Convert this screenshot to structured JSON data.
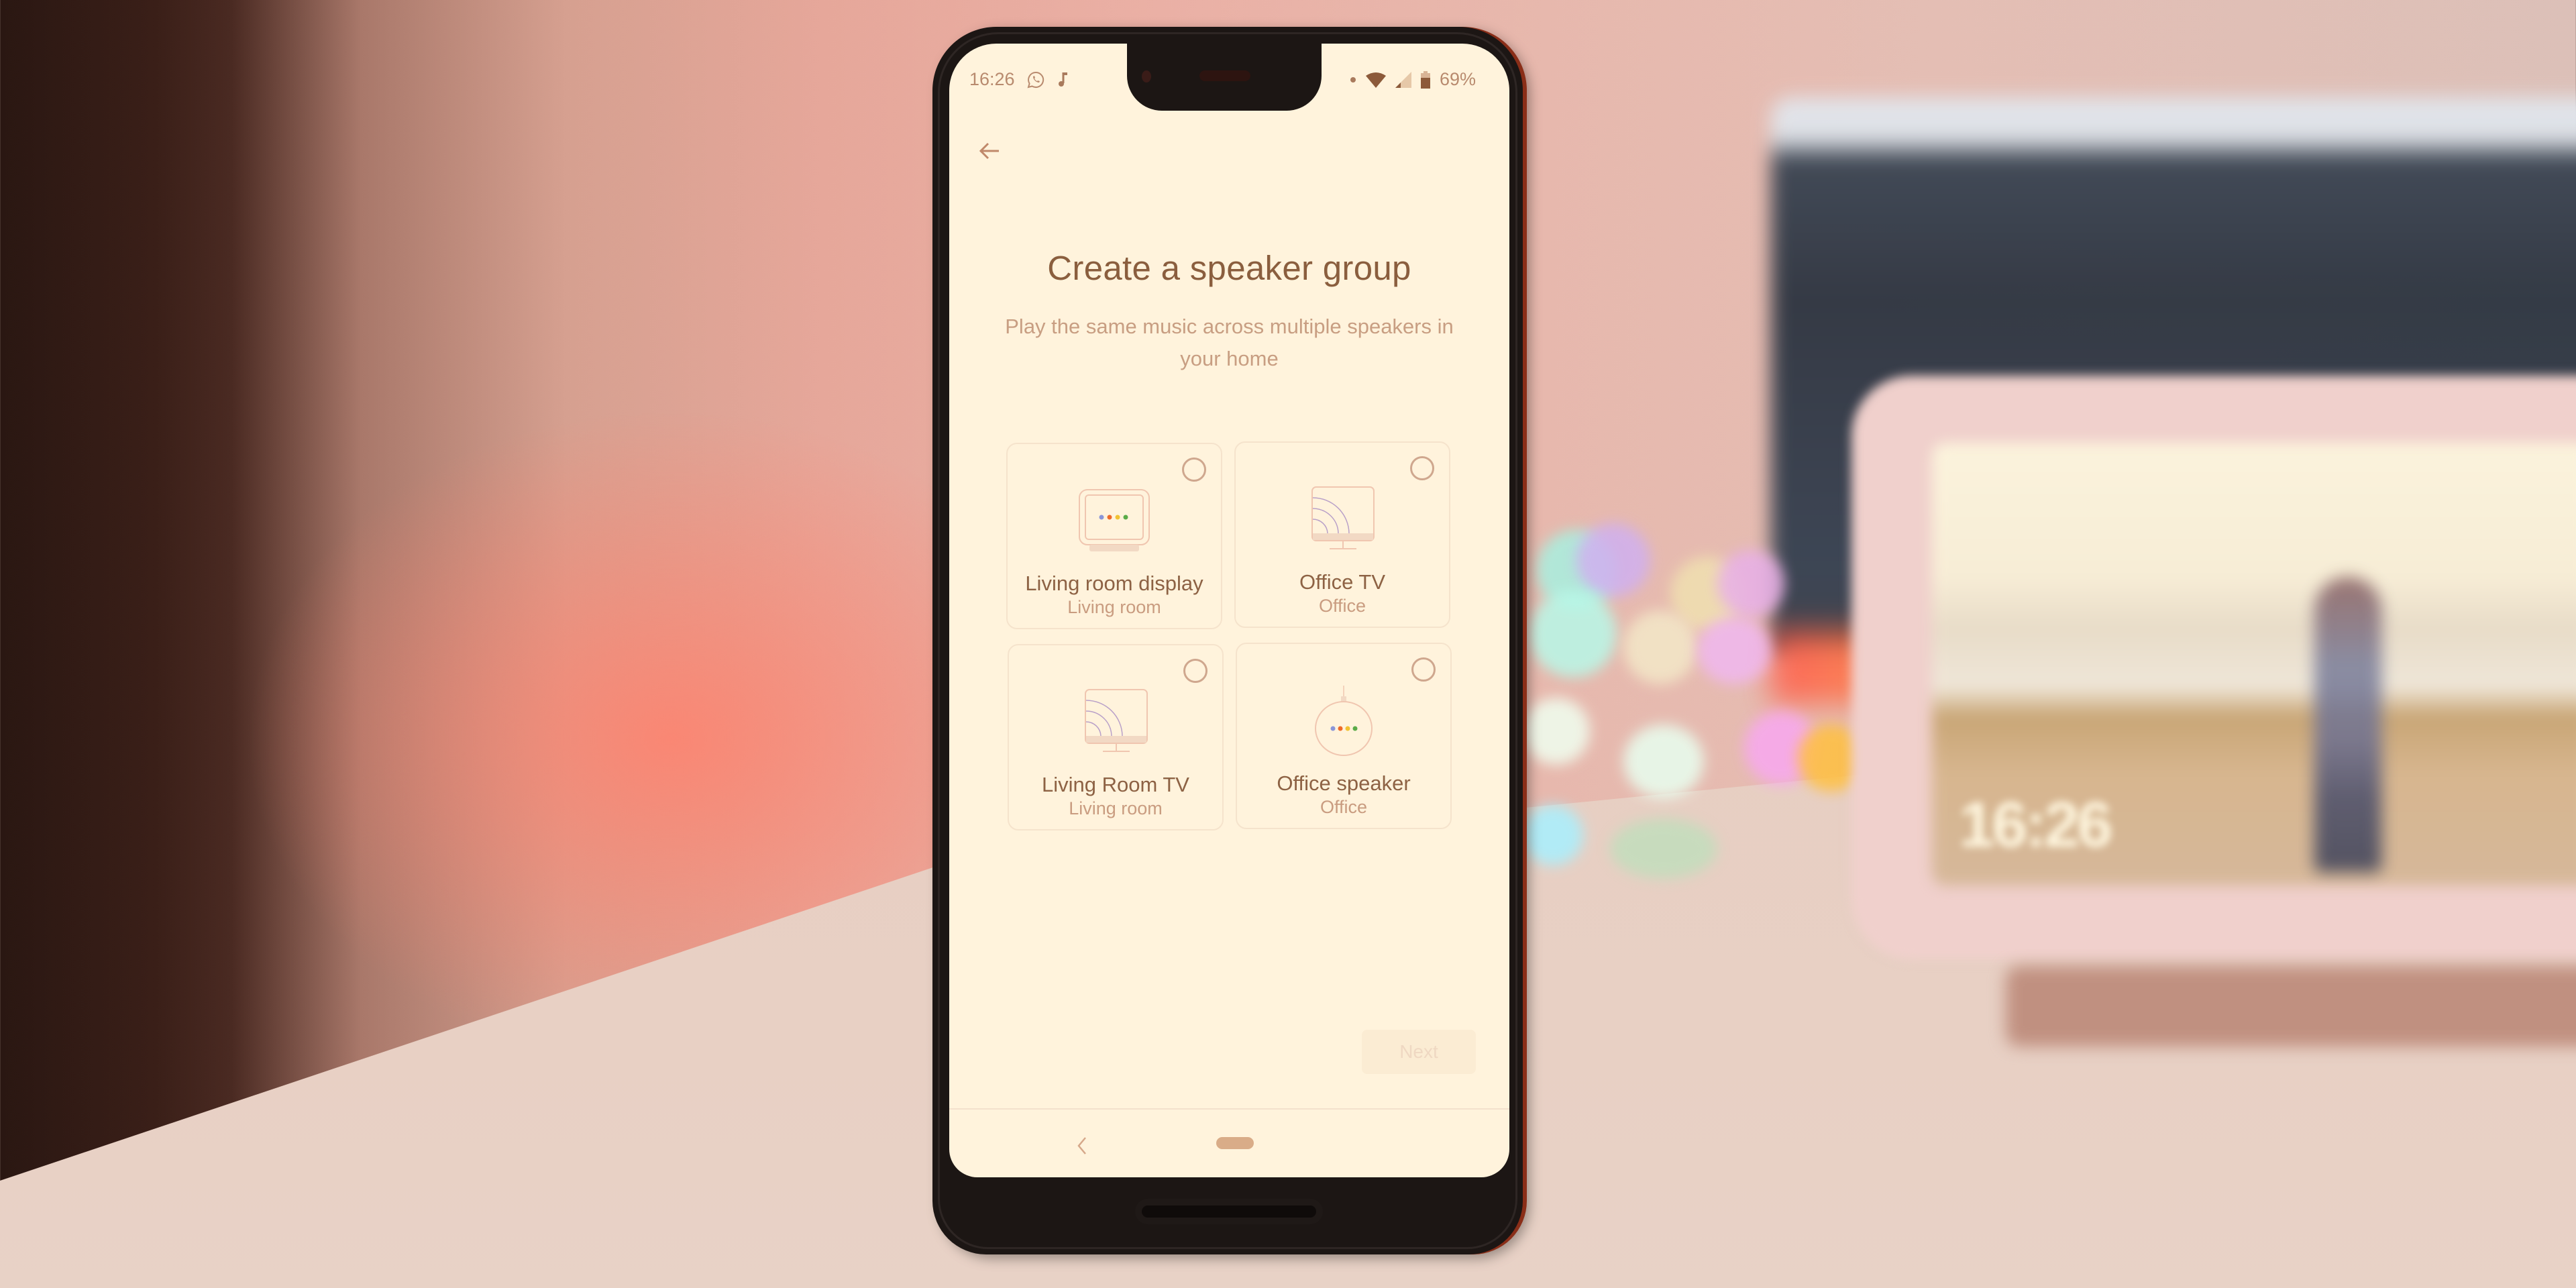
{
  "status_bar": {
    "time": "16:26",
    "left_icons": [
      "whatsapp-icon",
      "music-note-icon"
    ],
    "right_icons": [
      "notification-dot-icon",
      "wifi-icon",
      "cellular-signal-icon",
      "battery-icon"
    ],
    "battery_percent": "69%",
    "battery_level": 0.69
  },
  "toolbar": {
    "back_icon": "arrow-left-icon"
  },
  "header": {
    "title": "Create a speaker group",
    "subtitle_line1": "Play the same music across multiple speakers in",
    "subtitle_line2": "your home"
  },
  "devices": [
    {
      "name": "Living room display",
      "room": "Living room",
      "icon": "smart-display-icon",
      "selected": false
    },
    {
      "name": "Office TV",
      "room": "Office",
      "icon": "cast-tv-icon",
      "selected": false
    },
    {
      "name": "Living Room TV",
      "room": "Living room",
      "icon": "cast-tv-icon",
      "selected": false
    },
    {
      "name": "Office speaker",
      "room": "Office",
      "icon": "smart-speaker-icon",
      "selected": false
    }
  ],
  "footer": {
    "next_label": "Next",
    "next_enabled": false
  },
  "nav_bar": {
    "back_icon": "nav-back-icon",
    "home_icon": "home-pill-icon"
  },
  "assistant_dot_colors": [
    "#8a95d8",
    "#ef6a2a",
    "#f1c232",
    "#5aab48"
  ],
  "theme": {
    "screen_bg": "#fff3dc",
    "title_color": "#8a5e3e",
    "subtitle_color": "#c89e82"
  },
  "background_scene": {
    "hub_clock": "16:26"
  }
}
